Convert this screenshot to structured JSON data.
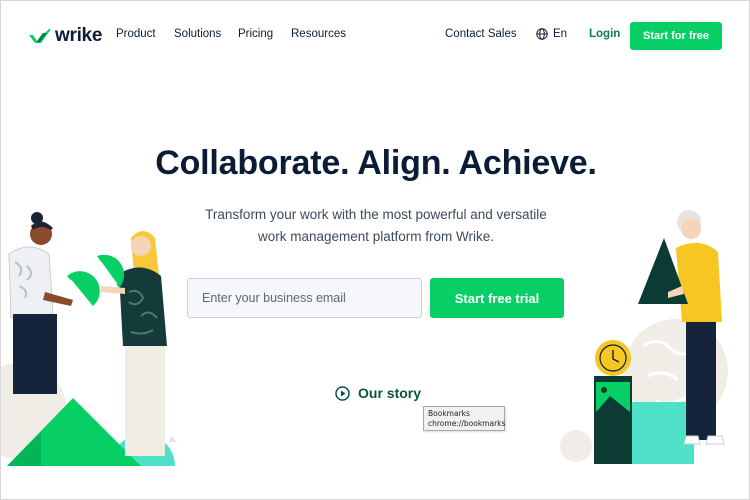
{
  "brand": {
    "name": "wrike",
    "accent": "#08cf65",
    "dark_text": "#0b1d36",
    "link_green": "#0b7d4a"
  },
  "nav": {
    "items": [
      "Product",
      "Solutions",
      "Pricing",
      "Resources"
    ],
    "contact_sales": "Contact Sales",
    "language": "En",
    "login": "Login",
    "cta": "Start for free"
  },
  "hero": {
    "title": "Collaborate. Align. Achieve.",
    "subtitle_line1": "Transform your work with the most powerful and versatile",
    "subtitle_line2": "work management platform from Wrike.",
    "email_placeholder": "Enter your business email",
    "email_value": "",
    "cta": "Start free trial",
    "story_link": "Our story"
  },
  "tooltip": {
    "title": "Bookmarks",
    "url": "chrome://bookmarks"
  },
  "icons": {
    "logo": "wrike-check-logo-icon",
    "language": "globe-icon",
    "story": "play-circle-icon"
  }
}
